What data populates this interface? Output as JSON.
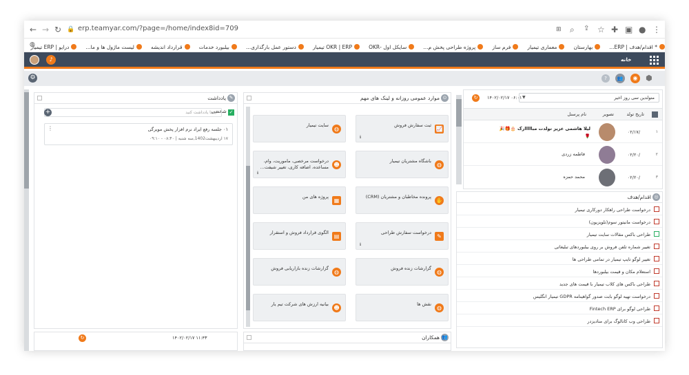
{
  "browser": {
    "url": "erp.teamyar.com/?page=/home/index8id=709"
  },
  "bookmarks": [
    "* اقدام/هدف | ERP...",
    "بهارستان",
    "معماری تیمیار",
    "فرم ساز",
    "پروژه طراحی پخش م...",
    "سایکل اول -OKR",
    "OKR | ERP تیمیار",
    "دستور عمل بارگذاری...",
    "بیلبورد خدمات",
    "قرارداد اندیشه",
    "لیست ماژول ها و ما...",
    "درایو | ERP تیمیار"
  ],
  "appbar": {
    "home_label": "خانه"
  },
  "birthdays": {
    "select_value": "متولدین سی روز اخیر",
    "headers": [
      "تاریخ تولد",
      "تصویر",
      "نام پرسنل"
    ],
    "rows": [
      {
        "num": "۱",
        "date": "۰۲/۱۷/",
        "name": "لیلا هاشمی عزیز تولدت مبااااارک 🎂🎁🎉🌹"
      },
      {
        "num": "۲",
        "date": "۰۲/۲۰/",
        "name": "فاطمه زردی"
      },
      {
        "num": "۳",
        "date": "۰۲/۲۰/",
        "name": "محمد حمزه"
      }
    ],
    "timestamp": "۱۴۰۲/۰۲/۱۷ ۰۶:۰۱"
  },
  "actions": {
    "title": "اقدام/هدف",
    "items": [
      "درخواست طراحی راهکار دورکاری تیمیار",
      "درخواست مانیتور سوم(تلویزیون)",
      "طراحی باکس مقالات سایت تیمیار",
      "تغییر شماره تلفن فروش بر روی بیلبوردهای تبلیغاتی",
      "تغییر لوگو تایپ تیمیار در تمامی طراحی ها",
      "استعلام مکان و قیمت بیلبوردها",
      "طراحی باکس های کلاب تیمیار با قیمت های جدید",
      "درخواست تهیه لوگو بابت صدور گواهینامه GDPR تیمیار انگلیس",
      "طراحی لوگو برای Fintech ERP",
      "طراحی وب کاتالوگ برای منادیزدر"
    ]
  },
  "links": {
    "title": "موارد عمومی روزانه و لینک های مهم",
    "tiles": [
      {
        "label": "ثبت سفارش فروش",
        "info": "ℹ"
      },
      {
        "label": "سایت تیمیار",
        "info": ""
      },
      {
        "label": "باشگاه مشتریان تیمیار",
        "info": ""
      },
      {
        "label": "درخواست مرخصی، ماموریت، وام، مساعده، اضافه کاری، تغییر شیفت...",
        "info": "ℹ"
      },
      {
        "label": "پرونده مخاطبان و مشتریان (CRM)",
        "info": ""
      },
      {
        "label": "پروژه های من",
        "info": ""
      },
      {
        "label": "درخواست سفارش طراحی",
        "info": "ℹ"
      },
      {
        "label": "الگوی قرارداد فروش و استقرار",
        "info": ""
      },
      {
        "label": "گزارشات زنده فروش",
        "info": ""
      },
      {
        "label": "گزارشات زنده بازاریابی فروش",
        "info": ""
      },
      {
        "label": "نقش ها",
        "info": ""
      },
      {
        "label": "بیانیه ارزش های شرکت تیم یار",
        "info": ""
      }
    ]
  },
  "colleagues": {
    "title": "همکاران"
  },
  "notes": {
    "title": "یادداشت",
    "tab_label": "شخصی",
    "placeholder": "اینجا یادداشت کنید",
    "note_title": "۰۱ جلسه رفع ایراد نرم افزار پخش مویرگی",
    "note_meta": "۱۷ اردیبهشت1402,سه شنبه | ۰۸:۴۰ - ۰۹:۱۰"
  },
  "bottom_panel": {
    "timestamp": "۱۴۰۲/۰۲/۱۷ ۱۱:۴۳"
  },
  "colors": {
    "accent": "#f07a1a",
    "header": "#3d4a5c"
  }
}
